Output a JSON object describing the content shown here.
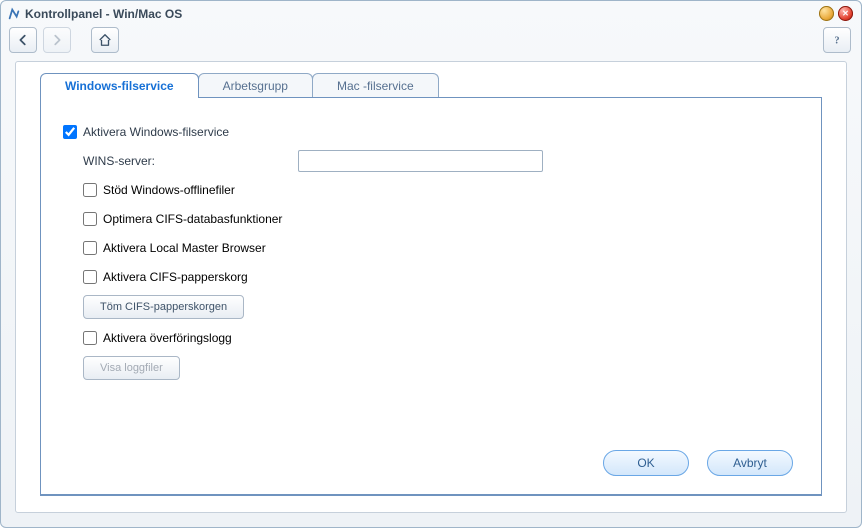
{
  "window": {
    "title": "Kontrollpanel - Win/Mac OS"
  },
  "tabs": [
    {
      "label": "Windows-filservice",
      "active": true
    },
    {
      "label": "Arbetsgrupp",
      "active": false
    },
    {
      "label": "Mac -filservice",
      "active": false
    }
  ],
  "form": {
    "activate_windows": {
      "label": "Aktivera Windows-filservice",
      "checked": true
    },
    "wins_label": "WINS-server:",
    "wins_value": "",
    "options": [
      {
        "id": "offline",
        "label": "Stöd Windows-offlinefiler",
        "checked": false
      },
      {
        "id": "cifs_db",
        "label": "Optimera CIFS-databasfunktioner",
        "checked": false
      },
      {
        "id": "lmb",
        "label": "Aktivera Local Master Browser",
        "checked": false
      },
      {
        "id": "trash",
        "label": "Aktivera CIFS-papperskorg",
        "checked": false
      },
      {
        "id": "xferlog",
        "label": "Aktivera överföringslogg",
        "checked": false
      }
    ],
    "empty_trash_btn": "Töm CIFS-papperskorgen",
    "view_logs_btn": "Visa loggfiler"
  },
  "footer": {
    "ok": "OK",
    "cancel": "Avbryt"
  }
}
